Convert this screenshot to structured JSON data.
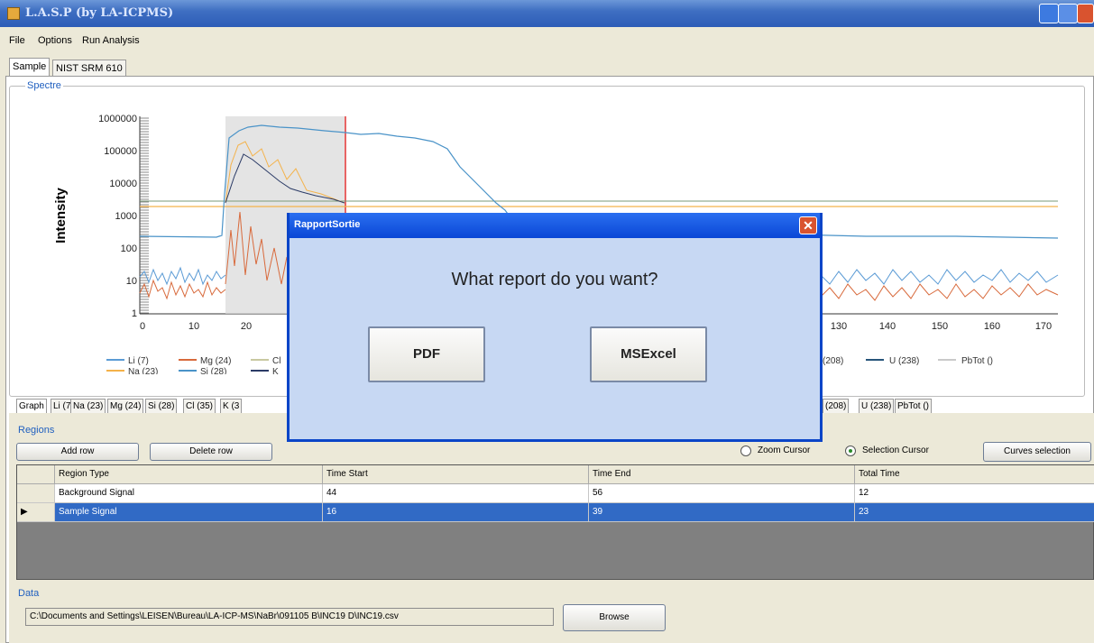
{
  "window": {
    "title": "L.A.S.P (by LA-ICPMS)"
  },
  "menu": [
    "File",
    "Options",
    "Run Analysis"
  ],
  "top_tabs": [
    "Sample",
    "NIST SRM 610"
  ],
  "spectre": {
    "group_label": "Spectre",
    "ylabel": "Intensity",
    "y_ticks": [
      "1000000",
      "100000",
      "10000",
      "1000",
      "100",
      "10",
      "1"
    ],
    "x_ticks_left": [
      "0",
      "10",
      "20"
    ],
    "x_ticks_right": [
      "130",
      "140",
      "150",
      "160",
      "170"
    ],
    "legend_left": [
      {
        "name": "Li (7)",
        "color": "#5b9bd5"
      },
      {
        "name": "Mg (24)",
        "color": "#d86a3c"
      },
      {
        "name": "Cl",
        "color": "#c8c8a0"
      },
      {
        "name": "Na (23)",
        "color": "#f4b24a"
      },
      {
        "name": "Si (28)",
        "color": "#4a93c8"
      },
      {
        "name": "K",
        "color": "#2b3b66"
      }
    ],
    "legend_right": [
      {
        "name": "(208)",
        "color": "#888888"
      },
      {
        "name": "U (238)",
        "color": "#27557a"
      },
      {
        "name": "PbTot ()",
        "color": "#c9c9c9"
      }
    ]
  },
  "element_tabs_left": [
    "Graph",
    "Li (7)",
    "Na (23)",
    "Mg (24)",
    "Si (28)",
    "Cl (35)",
    "K (3"
  ],
  "element_tabs_right": [
    "(208)",
    "U (238)",
    "PbTot ()"
  ],
  "regions": {
    "label": "Regions",
    "add_row": "Add row",
    "delete_row": "Delete row",
    "zoom_cursor": "Zoom Cursor",
    "selection_cursor": "Selection Cursor",
    "curves_selection": "Curves selection",
    "columns": [
      "Region Type",
      "Time Start",
      "Time End",
      "Total Time"
    ],
    "rows": [
      [
        "Background Signal",
        "44",
        "56",
        "12"
      ],
      [
        "Sample Signal",
        "16",
        "39",
        "23"
      ]
    ]
  },
  "data": {
    "label": "Data",
    "path": "C:\\Documents and Settings\\LEISEN\\Bureau\\LA-ICP-MS\\NaBr\\091105 B\\INC19 D\\INC19.csv",
    "browse": "Browse"
  },
  "dialog": {
    "title": "RapportSortie",
    "question": "What report do you want?",
    "pdf": "PDF",
    "excel": "MSExcel"
  }
}
